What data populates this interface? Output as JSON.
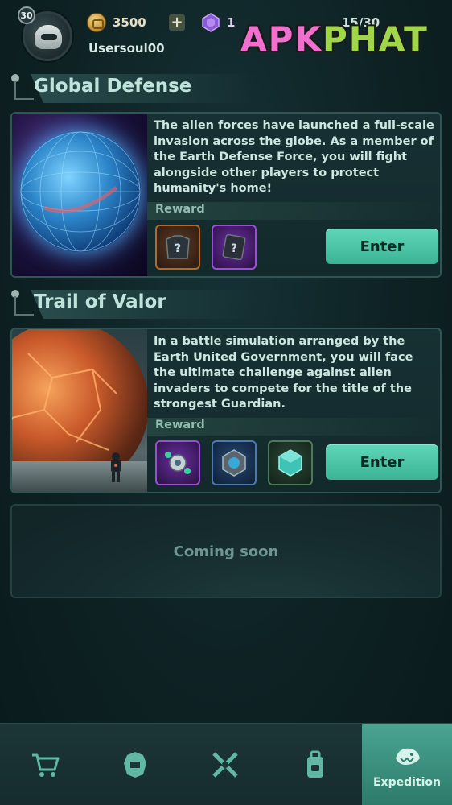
{
  "player": {
    "level": "30",
    "username": "Usersoul00"
  },
  "currency": {
    "coins": "3500",
    "plus_label": "+",
    "gems": "1",
    "energy": "15/30"
  },
  "watermark": {
    "part1": "APK",
    "part2": "PHAT"
  },
  "sections": [
    {
      "title": "Global Defense",
      "description": "The alien forces have launched a full-scale invasion across the globe. As a member of the Earth Defense Force, you will fight alongside other players to protect humanity's home!",
      "reward_label": "Reward",
      "enter_label": "Enter"
    },
    {
      "title": "Trail of Valor",
      "description": "In a battle simulation arranged by the Earth United Government, you will face the ultimate challenge against alien invaders to compete for the title of the strongest Guardian.",
      "reward_label": "Reward",
      "enter_label": "Enter"
    }
  ],
  "coming_soon": "Coming soon",
  "nav": {
    "items": [
      {
        "icon": "cart-icon",
        "label": ""
      },
      {
        "icon": "armor-icon",
        "label": ""
      },
      {
        "icon": "crossed-swords-icon",
        "label": ""
      },
      {
        "icon": "backpack-icon",
        "label": ""
      },
      {
        "icon": "expedition-icon",
        "label": "Expedition"
      }
    ],
    "active_index": 4
  },
  "colors": {
    "accent": "#4fc9a8",
    "background": "#0f2426",
    "title_text": "#bfe4dc"
  }
}
